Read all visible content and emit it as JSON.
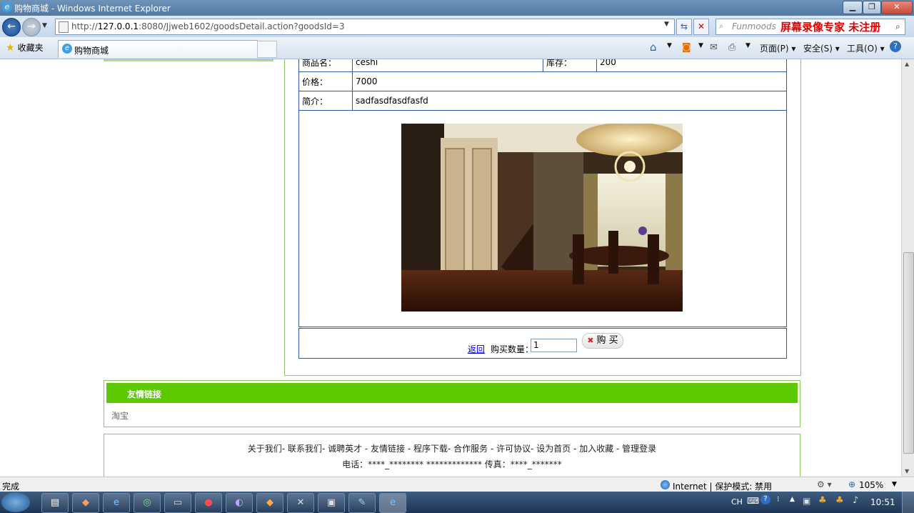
{
  "window": {
    "title": "购物商城 - Windows Internet Explorer"
  },
  "address_bar": {
    "url_prefix": "http://",
    "url_host": "127.0.0.1",
    "url_rest": ":8080/Jjweb1602/goodsDetail.action?goodsId=3"
  },
  "search_box": {
    "engine": "Funmoods",
    "overlay": "屏幕录像专家  未注册"
  },
  "favorites": {
    "label": "收藏夹"
  },
  "tab": {
    "title": "购物商城"
  },
  "commands": {
    "page": "页面(P)",
    "safety": "安全(S)",
    "tools": "工具(O)"
  },
  "product": {
    "name_label": "商品名：",
    "name_value": "ceshi",
    "stock_label": "库存：",
    "stock_value": "200",
    "price_label": "价格：",
    "price_value": "7000",
    "intro_label": "简介：",
    "intro_value": "sadfasdfasdfasfd"
  },
  "purchase": {
    "back_link": "返回",
    "quantity_label": "购买数量：",
    "quantity_value": "1",
    "buy_button": "购 买"
  },
  "friend_links": {
    "heading": "友情链接",
    "items": [
      "淘宝"
    ]
  },
  "footer": {
    "links_line": "关于我们- 联系我们- 诚聘英才 - 友情链接 - 程序下载- 合作服务 - 许可协议- 设为首页 - 加入收藏 - 管理登录",
    "contact_line": "电话：****_******** ************* 传真：****_*******"
  },
  "status_bar": {
    "text": "完成",
    "zone": "Internet | 保护模式: 禁用",
    "zoom": "105%"
  },
  "taskbar": {
    "ime": "CH",
    "clock": "10:51"
  },
  "colors": {
    "green_header": "#5cc800",
    "frame_green": "#8cc860",
    "table_border": "#2f5d9e",
    "overlay_red": "#e00000"
  }
}
